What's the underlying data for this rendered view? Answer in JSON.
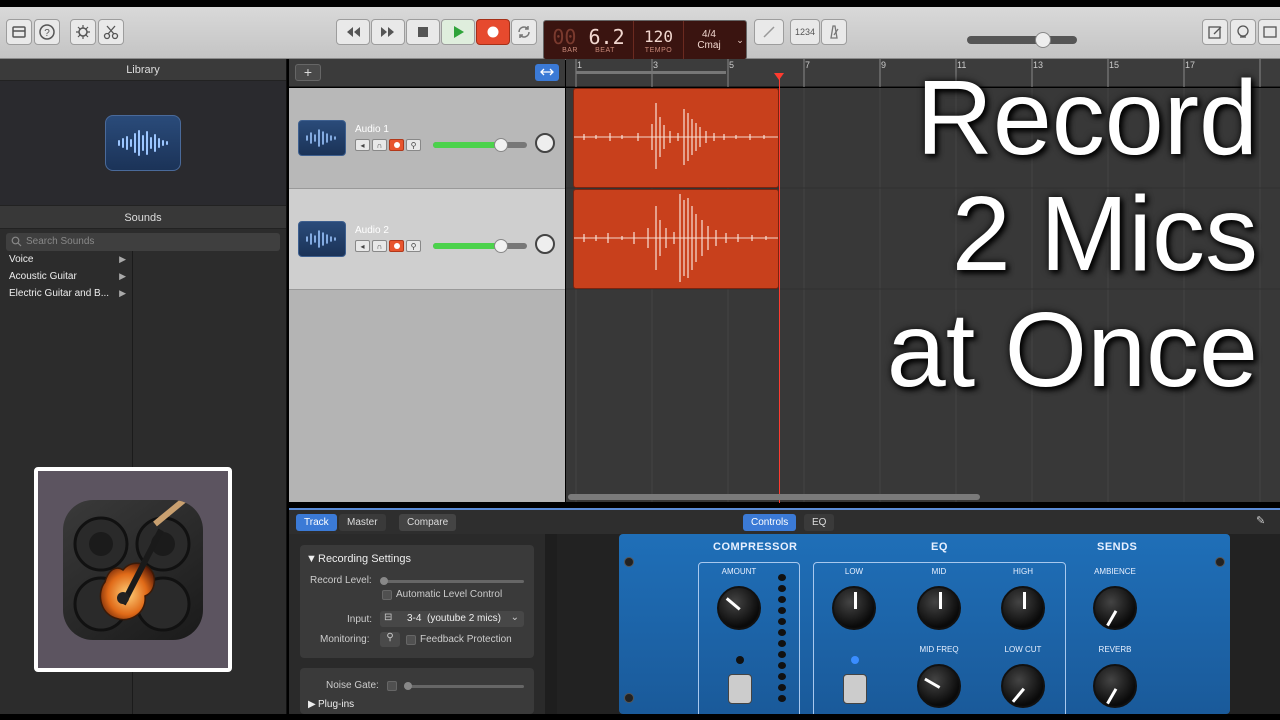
{
  "library": {
    "title": "Library",
    "sounds_title": "Sounds",
    "search_placeholder": "Search Sounds",
    "categories": [
      {
        "label": "Voice"
      },
      {
        "label": "Acoustic Guitar"
      },
      {
        "label": "Electric Guitar and B..."
      }
    ]
  },
  "lcd": {
    "bar": "00",
    "beat": "6.2",
    "bar_label": "BAR",
    "beat_label": "BEAT",
    "tempo": "120",
    "tempo_label": "TEMPO",
    "signature": "4/4",
    "key": "Cmaj"
  },
  "toolbar": {
    "count_in": "1234"
  },
  "tracks": [
    {
      "name": "Audio 1",
      "volume": 0.72
    },
    {
      "name": "Audio 2",
      "volume": 0.72
    }
  ],
  "ruler": {
    "bars": [
      "1",
      "3",
      "5",
      "7",
      "9",
      "11",
      "13",
      "15",
      "17"
    ]
  },
  "editor": {
    "tabs": [
      "Track",
      "Master",
      "Compare"
    ],
    "view_tabs": [
      "Controls",
      "EQ"
    ],
    "recording_settings": "Recording Settings",
    "record_level": "Record Level:",
    "auto_level": "Automatic Level Control",
    "input_label": "Input:",
    "input_value": "3-4  (youtube 2 mics)",
    "monitoring_label": "Monitoring:",
    "feedback": "Feedback Protection",
    "noise_gate": "Noise Gate:",
    "plugins": "Plug-ins"
  },
  "plugin": {
    "compressor": "COMPRESSOR",
    "eq": "EQ",
    "sends": "SENDS",
    "amount": "AMOUNT",
    "low": "LOW",
    "mid": "MID",
    "high": "HIGH",
    "ambience": "AMBIENCE",
    "mid_freq": "MID FREQ",
    "low_cut": "LOW CUT",
    "reverb": "REVERB"
  },
  "overlay": {
    "line1": "Record",
    "line2": "2 Mics",
    "line3": "at Once"
  },
  "colors": {
    "region": "#c8401c",
    "playhead": "#ff3b2f",
    "accent": "#3b7ad6",
    "plugin": "#1f6fb8"
  }
}
